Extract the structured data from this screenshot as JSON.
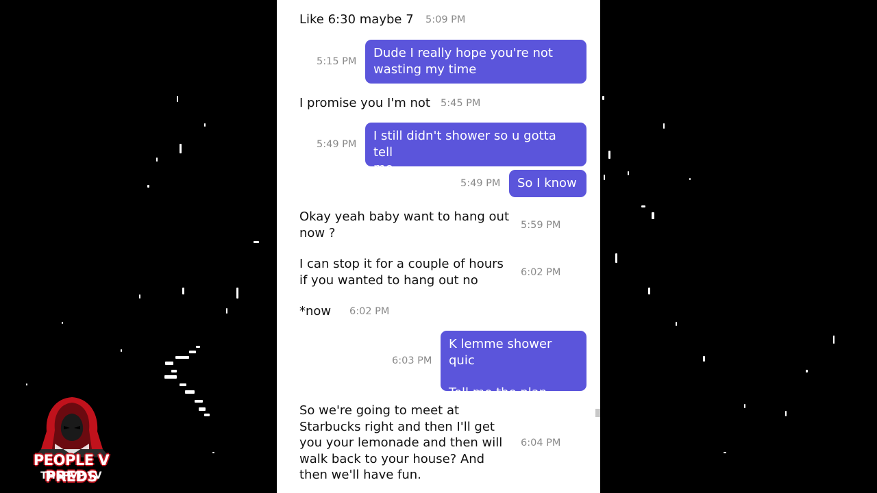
{
  "chat": {
    "messages": [
      {
        "direction": "in",
        "text": "Like 6:30 maybe 7",
        "time": "5:09 PM"
      },
      {
        "direction": "out",
        "text": "Dude I really hope you're not\nwasting my time",
        "time": "5:15 PM"
      },
      {
        "direction": "in",
        "text": "I promise you I'm not",
        "time": "5:45 PM"
      },
      {
        "direction": "out",
        "text": "I still didn't shower so u gotta tell\nme",
        "time": "5:49 PM"
      },
      {
        "direction": "out",
        "text": "So I know",
        "time": "5:49 PM"
      },
      {
        "direction": "in",
        "text": "Okay yeah baby want to hang out\nnow ?",
        "time": "5:59 PM"
      },
      {
        "direction": "in",
        "text": "I can stop it for a couple of hours\nif you wanted to hang out no",
        "time": "6:02 PM"
      },
      {
        "direction": "in",
        "text": "*now",
        "time": "6:02 PM"
      },
      {
        "direction": "out",
        "text": "K lemme shower quic\n\nTell me the plan",
        "time": "6:03 PM"
      },
      {
        "direction": "in",
        "text": "So we're going to meet at\nStarbucks right and then I'll get\nyou your lemonade and then will\nwalk back to your house? And\nthen we'll have fun.",
        "time": "6:04 PM"
      }
    ]
  },
  "watermark": {
    "title": "PEOPLE V PREDS",
    "subtitle": "THEPVP.TV"
  },
  "colors": {
    "outgoing_bubble": "#5b55db",
    "timestamp": "#8a8a8a",
    "panel_background": "#ffffff",
    "page_background": "#000000",
    "logo_red": "#c0121c"
  }
}
